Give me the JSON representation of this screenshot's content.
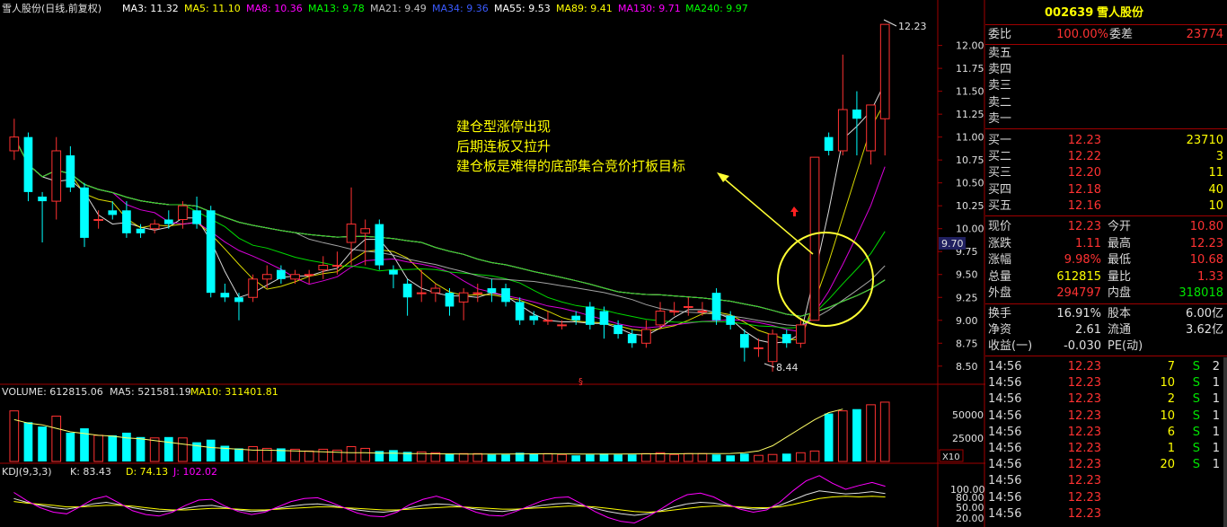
{
  "colors": {
    "up": "#ff3232",
    "down": "#00ffff",
    "grid": "#a00000",
    "title": "#ffff00"
  },
  "main_legend": {
    "title": "雪人股份(日线,前复权)",
    "items": [
      {
        "label": "MA3: 11.32",
        "color": "#ffffff"
      },
      {
        "label": "MA5: 11.10",
        "color": "#ffff00"
      },
      {
        "label": "MA8: 10.36",
        "color": "#ff00ff"
      },
      {
        "label": "MA13: 9.78",
        "color": "#00ff00"
      },
      {
        "label": "MA21: 9.49",
        "color": "#c0c0c0"
      },
      {
        "label": "MA34: 9.36",
        "color": "#3a5bff"
      },
      {
        "label": "MA55: 9.53",
        "color": "#ffffff"
      },
      {
        "label": "MA89: 9.41",
        "color": "#ffff00"
      },
      {
        "label": "MA130: 9.71",
        "color": "#ff00ff"
      },
      {
        "label": "MA240: 9.97",
        "color": "#00ff00"
      }
    ]
  },
  "price_axis": {
    "ticks": [
      "12.00",
      "11.75",
      "11.50",
      "11.25",
      "11.00",
      "10.75",
      "10.50",
      "10.25",
      "10.00",
      "9.75",
      "9.50",
      "9.25",
      "9.00",
      "8.75",
      "8.50"
    ],
    "marker": "9.70",
    "high_label": "12.23",
    "low_label": "8.44"
  },
  "annotation": {
    "line1": "建仓型涨停出现",
    "line2": "后期连板又拉升",
    "line3": "建仓板是难得的底部集合竞价打板目标"
  },
  "volume_legend": {
    "title": "VOLUME: 612815.06",
    "ma5": "MA5: 521581.19",
    "ma10": "MA10: 311401.81"
  },
  "volume_axis": {
    "ticks": [
      "50000",
      "25000"
    ],
    "unit": "X10"
  },
  "kdj_legend": {
    "title": "KDJ(9,3,3)",
    "k": "K: 83.43",
    "d": "D: 74.13",
    "j": "J: 102.02"
  },
  "kdj_axis": {
    "ticks": [
      "100.00",
      "80.00",
      "50.00",
      "20.00"
    ]
  },
  "chart_data": {
    "type": "candlestick",
    "ylim": [
      8.4,
      12.3
    ],
    "candles": [
      [
        10.85,
        11.0,
        10.75,
        11.2
      ],
      [
        11.0,
        10.4,
        10.3,
        11.05
      ],
      [
        10.35,
        10.3,
        9.85,
        10.4
      ],
      [
        10.3,
        10.85,
        10.1,
        11.0
      ],
      [
        10.8,
        10.45,
        10.4,
        10.9
      ],
      [
        10.45,
        9.9,
        9.8,
        10.5
      ],
      [
        10.1,
        10.1,
        10.0,
        10.2
      ],
      [
        10.2,
        10.15,
        10.1,
        10.3
      ],
      [
        10.2,
        9.95,
        9.9,
        10.3
      ],
      [
        10.0,
        9.95,
        9.9,
        10.05
      ],
      [
        10.0,
        10.05,
        9.95,
        10.1
      ],
      [
        10.1,
        10.05,
        10.0,
        10.2
      ],
      [
        10.1,
        10.25,
        10.0,
        10.3
      ],
      [
        10.2,
        10.05,
        10.0,
        10.35
      ],
      [
        10.2,
        9.3,
        9.25,
        10.25
      ],
      [
        9.3,
        9.25,
        9.2,
        9.4
      ],
      [
        9.25,
        9.2,
        9.0,
        9.3
      ],
      [
        9.25,
        9.45,
        9.2,
        9.5
      ],
      [
        9.45,
        9.5,
        9.35,
        9.6
      ],
      [
        9.55,
        9.45,
        9.4,
        9.6
      ],
      [
        9.45,
        9.5,
        9.4,
        9.55
      ],
      [
        9.5,
        9.5,
        9.4,
        9.55
      ],
      [
        9.55,
        9.6,
        9.45,
        9.7
      ],
      [
        9.6,
        9.6,
        9.5,
        9.75
      ],
      [
        9.85,
        10.05,
        9.6,
        10.45
      ],
      [
        9.95,
        10.0,
        9.6,
        10.1
      ],
      [
        10.05,
        9.6,
        9.55,
        10.1
      ],
      [
        9.55,
        9.5,
        9.35,
        9.6
      ],
      [
        9.4,
        9.25,
        9.05,
        9.45
      ],
      [
        9.3,
        9.3,
        9.2,
        9.55
      ],
      [
        9.3,
        9.35,
        9.2,
        9.4
      ],
      [
        9.3,
        9.15,
        9.05,
        9.35
      ],
      [
        9.2,
        9.3,
        9.0,
        9.35
      ],
      [
        9.3,
        9.3,
        9.2,
        9.4
      ],
      [
        9.35,
        9.3,
        9.2,
        9.45
      ],
      [
        9.35,
        9.2,
        9.15,
        9.4
      ],
      [
        9.2,
        9.0,
        8.95,
        9.25
      ],
      [
        9.05,
        9.0,
        8.95,
        9.1
      ],
      [
        9.0,
        9.0,
        8.95,
        9.1
      ],
      [
        8.95,
        8.95,
        8.9,
        9.0
      ],
      [
        9.05,
        9.0,
        8.95,
        9.1
      ],
      [
        9.15,
        8.95,
        8.9,
        9.2
      ],
      [
        9.1,
        8.95,
        8.8,
        9.15
      ],
      [
        8.95,
        8.85,
        8.8,
        9.0
      ],
      [
        8.85,
        8.75,
        8.7,
        8.9
      ],
      [
        8.75,
        8.9,
        8.7,
        9.0
      ],
      [
        8.95,
        9.1,
        8.9,
        9.2
      ],
      [
        9.1,
        9.1,
        9.05,
        9.2
      ],
      [
        9.15,
        9.15,
        9.05,
        9.25
      ],
      [
        9.1,
        9.1,
        9.05,
        9.2
      ],
      [
        9.3,
        9.0,
        8.95,
        9.35
      ],
      [
        9.05,
        8.95,
        8.9,
        9.1
      ],
      [
        8.85,
        8.7,
        8.55,
        8.9
      ],
      [
        8.7,
        8.7,
        8.6,
        8.8
      ],
      [
        8.55,
        8.85,
        8.44,
        8.9
      ],
      [
        8.85,
        8.75,
        8.7,
        8.9
      ],
      [
        8.75,
        8.95,
        8.7,
        9.0
      ],
      [
        9.0,
        10.78,
        9.0,
        10.78
      ],
      [
        11.0,
        10.85,
        10.8,
        11.05
      ],
      [
        10.85,
        11.3,
        10.8,
        11.9
      ],
      [
        11.3,
        11.2,
        10.8,
        11.5
      ],
      [
        10.85,
        11.35,
        10.7,
        11.35
      ],
      [
        11.2,
        12.23,
        10.8,
        12.23
      ]
    ],
    "volume_ylim": [
      0,
      70000
    ],
    "volume": [
      58000,
      45000,
      40000,
      52000,
      33000,
      38000,
      30000,
      30000,
      33000,
      28000,
      27000,
      28000,
      27000,
      22000,
      25000,
      18000,
      15000,
      17000,
      15000,
      15000,
      14000,
      12000,
      14000,
      13000,
      17000,
      15000,
      12000,
      13000,
      11000,
      11000,
      10000,
      9000,
      9000,
      9000,
      8000,
      8000,
      10000,
      9000,
      9000,
      8000,
      7000,
      8000,
      9000,
      8000,
      8000,
      9000,
      10000,
      8000,
      9000,
      9000,
      8000,
      7000,
      9000,
      7000,
      8000,
      9000,
      10000,
      12000,
      55000,
      58000,
      60000,
      65000,
      68000,
      70000
    ],
    "volume_ma5": [
      48000,
      44000,
      42000,
      38000,
      34000,
      32000,
      30000,
      29000,
      27000,
      26000,
      24000,
      22000,
      20000,
      18000,
      16000,
      15000,
      14000,
      13000,
      13000,
      12500,
      12000,
      11500,
      11000,
      10500,
      10000,
      10000,
      9500,
      9500,
      9000,
      9000,
      8800,
      8600,
      8500,
      8500,
      8500,
      8500,
      8600,
      8700,
      8700,
      8600,
      8500,
      8500,
      8500,
      8500,
      8600,
      8700,
      8800,
      8900,
      9000,
      9000,
      9000,
      9200,
      10000,
      12000,
      18000,
      28000,
      38000,
      48000,
      56000,
      60000
    ],
    "kdj_ylim": [
      0,
      120
    ],
    "kdj_k": [
      70,
      60,
      52,
      46,
      42,
      48,
      56,
      60,
      54,
      46,
      40,
      36,
      38,
      44,
      50,
      52,
      46,
      40,
      36,
      38,
      44,
      50,
      54,
      56,
      52,
      46,
      40,
      36,
      34,
      38,
      46,
      52,
      56,
      54,
      48,
      42,
      38,
      36,
      40,
      46,
      52,
      56,
      58,
      52,
      44,
      36,
      30,
      26,
      30,
      38,
      48,
      56,
      60,
      58,
      52,
      46,
      42,
      44,
      52,
      66,
      80,
      90,
      86,
      82,
      84,
      88,
      83
    ],
    "kdj_d": [
      62,
      58,
      55,
      52,
      48,
      48,
      50,
      52,
      52,
      50,
      46,
      42,
      40,
      40,
      42,
      44,
      44,
      42,
      40,
      40,
      42,
      44,
      46,
      48,
      48,
      46,
      44,
      42,
      40,
      40,
      42,
      44,
      46,
      48,
      48,
      46,
      44,
      42,
      42,
      44,
      46,
      48,
      50,
      50,
      48,
      44,
      40,
      36,
      34,
      36,
      40,
      44,
      48,
      50,
      50,
      48,
      46,
      46,
      48,
      54,
      62,
      70,
      74,
      76,
      74,
      76,
      74
    ],
    "kdj_j": [
      86,
      64,
      46,
      34,
      30,
      48,
      68,
      76,
      58,
      38,
      28,
      24,
      34,
      52,
      66,
      68,
      50,
      36,
      28,
      34,
      48,
      62,
      70,
      72,
      60,
      46,
      32,
      24,
      22,
      34,
      54,
      68,
      76,
      66,
      48,
      34,
      26,
      24,
      36,
      50,
      64,
      72,
      74,
      56,
      36,
      20,
      10,
      6,
      22,
      42,
      64,
      80,
      84,
      74,
      56,
      42,
      34,
      40,
      60,
      90,
      116,
      130,
      110,
      94,
      104,
      112,
      102
    ]
  },
  "quote": {
    "code": "002639",
    "name": "雪人股份",
    "weibi_label": "委比",
    "weibi": "100.00%",
    "weicha_label": "委差",
    "weicha": "23774",
    "sell": [
      {
        "label": "卖五"
      },
      {
        "label": "卖四"
      },
      {
        "label": "卖三"
      },
      {
        "label": "卖二"
      },
      {
        "label": "卖一"
      }
    ],
    "buy": [
      {
        "label": "买一",
        "price": "12.23",
        "vol": "23710"
      },
      {
        "label": "买二",
        "price": "12.22",
        "vol": "3"
      },
      {
        "label": "买三",
        "price": "12.20",
        "vol": "11"
      },
      {
        "label": "买四",
        "price": "12.18",
        "vol": "40"
      },
      {
        "label": "买五",
        "price": "12.16",
        "vol": "10"
      }
    ],
    "stats": [
      {
        "l1": "现价",
        "v1": "12.23",
        "c1": "red",
        "l2": "今开",
        "v2": "10.80",
        "c2": "red"
      },
      {
        "l1": "涨跌",
        "v1": "1.11",
        "c1": "red",
        "l2": "最高",
        "v2": "12.23",
        "c2": "red"
      },
      {
        "l1": "涨幅",
        "v1": "9.98%",
        "c1": "red",
        "l2": "最低",
        "v2": "10.68",
        "c2": "red"
      },
      {
        "l1": "总量",
        "v1": "612815",
        "c1": "yel",
        "l2": "量比",
        "v2": "1.33",
        "c2": "red"
      },
      {
        "l1": "外盘",
        "v1": "294797",
        "c1": "red",
        "l2": "内盘",
        "v2": "318018",
        "c2": "grn"
      }
    ],
    "stats2": [
      {
        "l1": "换手",
        "v1": "16.91%",
        "l2": "股本",
        "v2": "6.00亿"
      },
      {
        "l1": "净资",
        "v1": "2.61",
        "l2": "流通",
        "v2": "3.62亿"
      },
      {
        "l1": "收益(一)",
        "v1": "-0.030",
        "l2": "PE(动)",
        "v2": ""
      }
    ],
    "ticks": [
      {
        "time": "14:56",
        "price": "12.23",
        "vol": "7",
        "side": "S",
        "n": "2"
      },
      {
        "time": "14:56",
        "price": "12.23",
        "vol": "10",
        "side": "S",
        "n": "1"
      },
      {
        "time": "14:56",
        "price": "12.23",
        "vol": "2",
        "side": "S",
        "n": "1"
      },
      {
        "time": "14:56",
        "price": "12.23",
        "vol": "10",
        "side": "S",
        "n": "1"
      },
      {
        "time": "14:56",
        "price": "12.23",
        "vol": "6",
        "side": "S",
        "n": "1"
      },
      {
        "time": "14:56",
        "price": "12.23",
        "vol": "1",
        "side": "S",
        "n": "1"
      },
      {
        "time": "14:56",
        "price": "12.23",
        "vol": "20",
        "side": "S",
        "n": "1"
      },
      {
        "time": "14:56",
        "price": "12.23",
        "vol": "",
        "side": "",
        "n": ""
      },
      {
        "time": "14:56",
        "price": "12.23",
        "vol": "",
        "side": "",
        "n": ""
      },
      {
        "time": "14:56",
        "price": "12.23",
        "vol": "",
        "side": "",
        "n": ""
      }
    ]
  }
}
